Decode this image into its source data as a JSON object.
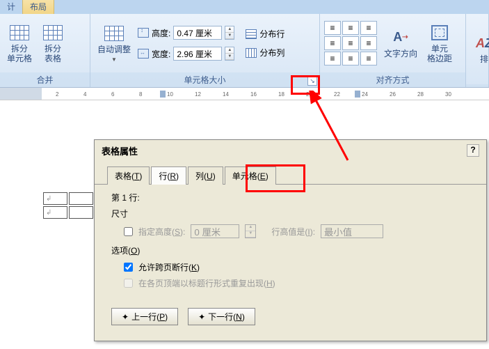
{
  "tabs": {
    "design": "计",
    "layout": "布局"
  },
  "ribbon": {
    "merge": {
      "splitCell": "拆分\n单元格",
      "splitTable": "拆分\n表格",
      "groupLabel": "合并"
    },
    "cellSize": {
      "autofit": "自动调整",
      "heightLabel": "高度:",
      "heightValue": "0.47 厘米",
      "widthLabel": "宽度:",
      "widthValue": "2.96 厘米",
      "distRows": "分布行",
      "distCols": "分布列",
      "groupLabel": "单元格大小"
    },
    "align": {
      "textDir": "文字方向",
      "cellMargin": "单元\n格边距",
      "groupLabel": "对齐方式"
    },
    "arrange": "排"
  },
  "dialog": {
    "title": "表格属性",
    "tabs": {
      "table": "表格(T)",
      "row": "行(R)",
      "column": "列(U)",
      "cell": "单元格(E)"
    },
    "rowHeader": "第 1 行:",
    "sizeSection": "尺寸",
    "specifyHeight": "指定高度(S):",
    "heightPlaceholder": "0 厘米",
    "rowHeightIs": "行高值是(I):",
    "minValue": "最小值",
    "optionsSection": "选项(O)",
    "allowBreak": "允许跨页断行(K)",
    "repeatHeader": "在各页顶端以标题行形式重复出现(H)",
    "prevRow": "上一行(P)",
    "nextRow": "下一行(N)"
  }
}
